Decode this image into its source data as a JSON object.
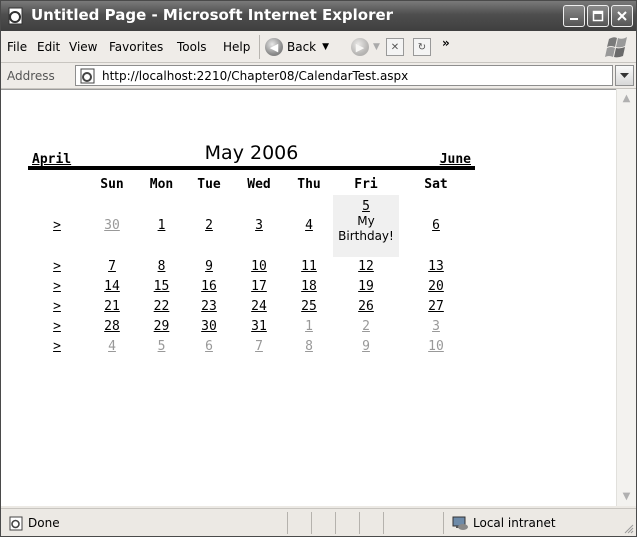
{
  "window": {
    "title": "Untitled Page - Microsoft Internet Explorer"
  },
  "menu": {
    "file": "File",
    "edit": "Edit",
    "view": "View",
    "favorites": "Favorites",
    "tools": "Tools",
    "help": "Help",
    "back": "Back",
    "more": "»"
  },
  "address": {
    "label": "Address",
    "url": "http://localhost:2210/Chapter08/CalendarTest.aspx"
  },
  "calendar": {
    "prev": "April",
    "title": "May 2006",
    "next": "June",
    "week_selector": ">",
    "days": [
      "Sun",
      "Mon",
      "Tue",
      "Wed",
      "Thu",
      "Fri",
      "Sat"
    ],
    "weeks": [
      [
        {
          "d": "30",
          "o": true
        },
        {
          "d": "1"
        },
        {
          "d": "2"
        },
        {
          "d": "3"
        },
        {
          "d": "4"
        },
        {
          "d": "5",
          "note": "My Birthday!"
        },
        {
          "d": "6"
        }
      ],
      [
        {
          "d": "7"
        },
        {
          "d": "8"
        },
        {
          "d": "9"
        },
        {
          "d": "10"
        },
        {
          "d": "11"
        },
        {
          "d": "12"
        },
        {
          "d": "13"
        }
      ],
      [
        {
          "d": "14"
        },
        {
          "d": "15"
        },
        {
          "d": "16"
        },
        {
          "d": "17"
        },
        {
          "d": "18"
        },
        {
          "d": "19"
        },
        {
          "d": "20"
        }
      ],
      [
        {
          "d": "21"
        },
        {
          "d": "22"
        },
        {
          "d": "23"
        },
        {
          "d": "24"
        },
        {
          "d": "25"
        },
        {
          "d": "26"
        },
        {
          "d": "27"
        }
      ],
      [
        {
          "d": "28"
        },
        {
          "d": "29"
        },
        {
          "d": "30"
        },
        {
          "d": "31"
        },
        {
          "d": "1",
          "o": true
        },
        {
          "d": "2",
          "o": true
        },
        {
          "d": "3",
          "o": true
        }
      ],
      [
        {
          "d": "4",
          "o": true
        },
        {
          "d": "5",
          "o": true
        },
        {
          "d": "6",
          "o": true
        },
        {
          "d": "7",
          "o": true
        },
        {
          "d": "8",
          "o": true
        },
        {
          "d": "9",
          "o": true
        },
        {
          "d": "10",
          "o": true
        }
      ]
    ]
  },
  "status": {
    "text": "Done",
    "zone": "Local intranet"
  }
}
